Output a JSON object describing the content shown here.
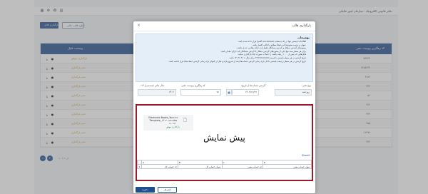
{
  "app": {
    "title": "دفاتر قانونی الکترونیک - سازمان امور مالیاتی",
    "toolbar_icons": [
      "grid-icon",
      "settings-icon",
      "lock-icon",
      "menu-icon"
    ],
    "icon_glyphs": [
      "▦",
      "⚙",
      "✪",
      "▤"
    ]
  },
  "page_buttons": {
    "upload_template": "بارگذاری فایل",
    "download_empty_template": "دانلود قالب خالی"
  },
  "background_table": {
    "col_status": "وضعیت فایل",
    "col_tracking": "کد رهگیری پیوست دفتر",
    "rows": [
      {
        "status": "بارگذاری موفق",
        "code": "۵۹۴۴۳"
      },
      {
        "status": "عدم بارگذاری",
        "code": "۶۷۸۵۳۶۹"
      },
      {
        "status": "عدم بارگذاری",
        "code": "۶۷۸۹"
      },
      {
        "status": "عدم بارگذاری",
        "code": "۳۳۴"
      },
      {
        "status": "عدم بارگذاری",
        "code": "۵۶"
      },
      {
        "status": "عدم بارگذاری",
        "code": "۲۲۲"
      },
      {
        "status": "عدم بارگذاری",
        "code": "۳۳۳"
      },
      {
        "status": "عدم بارگذاری",
        "code": "۴۵۵"
      },
      {
        "status": "عدم بارگذاری",
        "code": "۱۲۳۹۹"
      },
      {
        "status": "عدم بارگذاری",
        "code": "۴۴۴"
      }
    ]
  },
  "pager": {
    "pages": [
      "۱",
      "۲"
    ],
    "info": "۱۰ از ۱-۱"
  },
  "modal": {
    "title": "بارگذاری قالب",
    "close_glyph": "×",
    "help_title": "توضیحات",
    "help_items": [
      "اطلاعات بایستی تنها در یک (صفحه) worksheet اکسل قرار داده شده باشد.",
      "عنوان و ترتیب ستون‌ها باید دقیقاً مطابق با قالب اکسل باشد.",
      "ستون‌های گردش بدهکار و گردش بستانکار فقط باید دارای مقادیر عددی باشند.",
      "برای هر سطر سند تنها یکی از ستون‌های گردش بدهکار یا گردش بستانکار باید دارای مقدار باشد.",
      "فایل‌هایی که بیش از ۱۰۰۰ ردیف باشند را حتماً به صورت zip بارگذاری نمایید.",
      "تاریخ گردش در هر سطر بایستی با فرمت YYYY/mm/dd برای مثال ۱۴۰۳/۰۳/۰۱ باشد.",
      "تاریخ گردش در هر سطر (ردیف) بایستی داخل بازه زمانی گردش حساب‌ها (بعد از شروع بازه و قبل از انتهای بازه زمانی گردش حساب‌ها) قرار داشته باشد."
    ],
    "form": {
      "ledger_type_label": "نوع دفتر:",
      "ledger_type_value": "روزنامه",
      "period_label": "گردش حساب‌ها از تاریخ:",
      "period_from": "۱۴۰۲/۰۱/۰۱",
      "period_to": "۱۴۰۲/۱۲/۲۹",
      "tracking_label": "کد رهگیری پیوست دفتر:",
      "tracking_value": "۷۶",
      "fiscal_year_label": "سال مالی (شمسی) ۱۴:",
      "fiscal_year_value": "۱۴۰۲"
    },
    "calendar_icon": "▦",
    "preview": {
      "file_name": "Electronic Books_Ya۶۶۶۶۶ Template_۱۴۰۳۰۱۲۳.xlsx",
      "file_size": "۵۹.۱ KB",
      "file_icon": "🗋",
      "file_link": "بارگذاری موفق",
      "title": "پیش نمایش",
      "sheet_label": "Sheet1",
      "grid_headers": [
        "A",
        "B",
        "C",
        "D"
      ],
      "grid_row1": [
        "کد حساب کل",
        "عنوان حساب کل",
        "کد حساب معین",
        "عنوان حساب معین"
      ],
      "grid_row1_num": "1"
    },
    "save_label": "ذخیره",
    "cancel_label": "انصراف"
  }
}
